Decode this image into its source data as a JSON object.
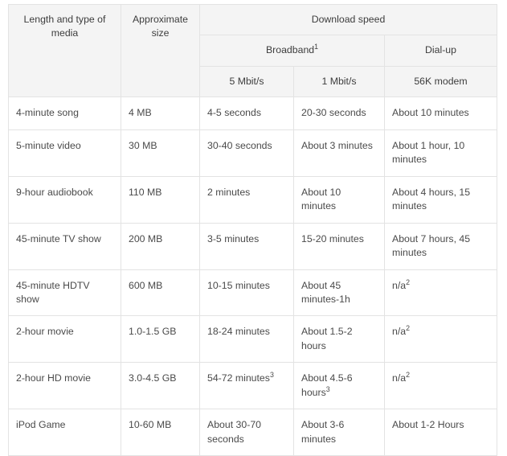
{
  "table": {
    "name": "download-speed-table",
    "header": {
      "stub_col1": "Length and type of media",
      "stub_col2": "Approximate size",
      "group_download_speed": "Download speed",
      "group_broadband": "Broadband",
      "group_broadband_footnote": "1",
      "group_dialup": "Dial-up",
      "sub_5mbit": "5 Mbit/s",
      "sub_1mbit": "1 Mbit/s",
      "sub_56k": "56K modem"
    },
    "rows": [
      {
        "media": "4-minute song",
        "size": "4 MB",
        "broadband_5mbit": "4-5 seconds",
        "broadband_5mbit_footnote": "",
        "broadband_1mbit": "20-30 seconds",
        "broadband_1mbit_footnote": "",
        "dialup": "About 10 minutes",
        "dialup_footnote": ""
      },
      {
        "media": "5-minute video",
        "size": "30 MB",
        "broadband_5mbit": "30-40 seconds",
        "broadband_5mbit_footnote": "",
        "broadband_1mbit": "About 3 minutes",
        "broadband_1mbit_footnote": "",
        "dialup": "About 1 hour, 10 minutes",
        "dialup_footnote": ""
      },
      {
        "media": "9-hour audiobook",
        "size": "110 MB",
        "broadband_5mbit": "2 minutes",
        "broadband_5mbit_footnote": "",
        "broadband_1mbit": "About 10 minutes",
        "broadband_1mbit_footnote": "",
        "dialup": "About 4 hours, 15 minutes",
        "dialup_footnote": ""
      },
      {
        "media": "45-minute TV show",
        "size": "200 MB",
        "broadband_5mbit": "3-5 minutes",
        "broadband_5mbit_footnote": "",
        "broadband_1mbit": "15-20 minutes",
        "broadband_1mbit_footnote": "",
        "dialup": "About 7 hours, 45 minutes",
        "dialup_footnote": ""
      },
      {
        "media": "45-minute HDTV show",
        "size": "600 MB",
        "broadband_5mbit": "10-15 minutes",
        "broadband_5mbit_footnote": "",
        "broadband_1mbit": "About 45 minutes-1h",
        "broadband_1mbit_footnote": "",
        "dialup": "n/a",
        "dialup_footnote": "2"
      },
      {
        "media": "2-hour movie",
        "size": "1.0-1.5 GB",
        "broadband_5mbit": "18-24 minutes",
        "broadband_5mbit_footnote": "",
        "broadband_1mbit": "About 1.5-2 hours",
        "broadband_1mbit_footnote": "",
        "dialup": "n/a",
        "dialup_footnote": "2"
      },
      {
        "media": "2-hour HD movie",
        "size": "3.0-4.5 GB",
        "broadband_5mbit": "54-72 minutes",
        "broadband_5mbit_footnote": "3",
        "broadband_1mbit": "About 4.5-6 hours",
        "broadband_1mbit_footnote": "3",
        "dialup": "n/a",
        "dialup_footnote": "2"
      },
      {
        "media": "iPod Game",
        "size": "10-60 MB",
        "broadband_5mbit": "About 30-70 seconds",
        "broadband_5mbit_footnote": "",
        "broadband_1mbit": "About 3-6 minutes",
        "broadband_1mbit_footnote": "",
        "dialup": "About 1-2 Hours",
        "dialup_footnote": ""
      }
    ]
  },
  "colors": {
    "header_background": "#f4f4f4",
    "body_background": "#ffffff",
    "border": "#e3e3e3",
    "text": "#4a4a4a"
  }
}
